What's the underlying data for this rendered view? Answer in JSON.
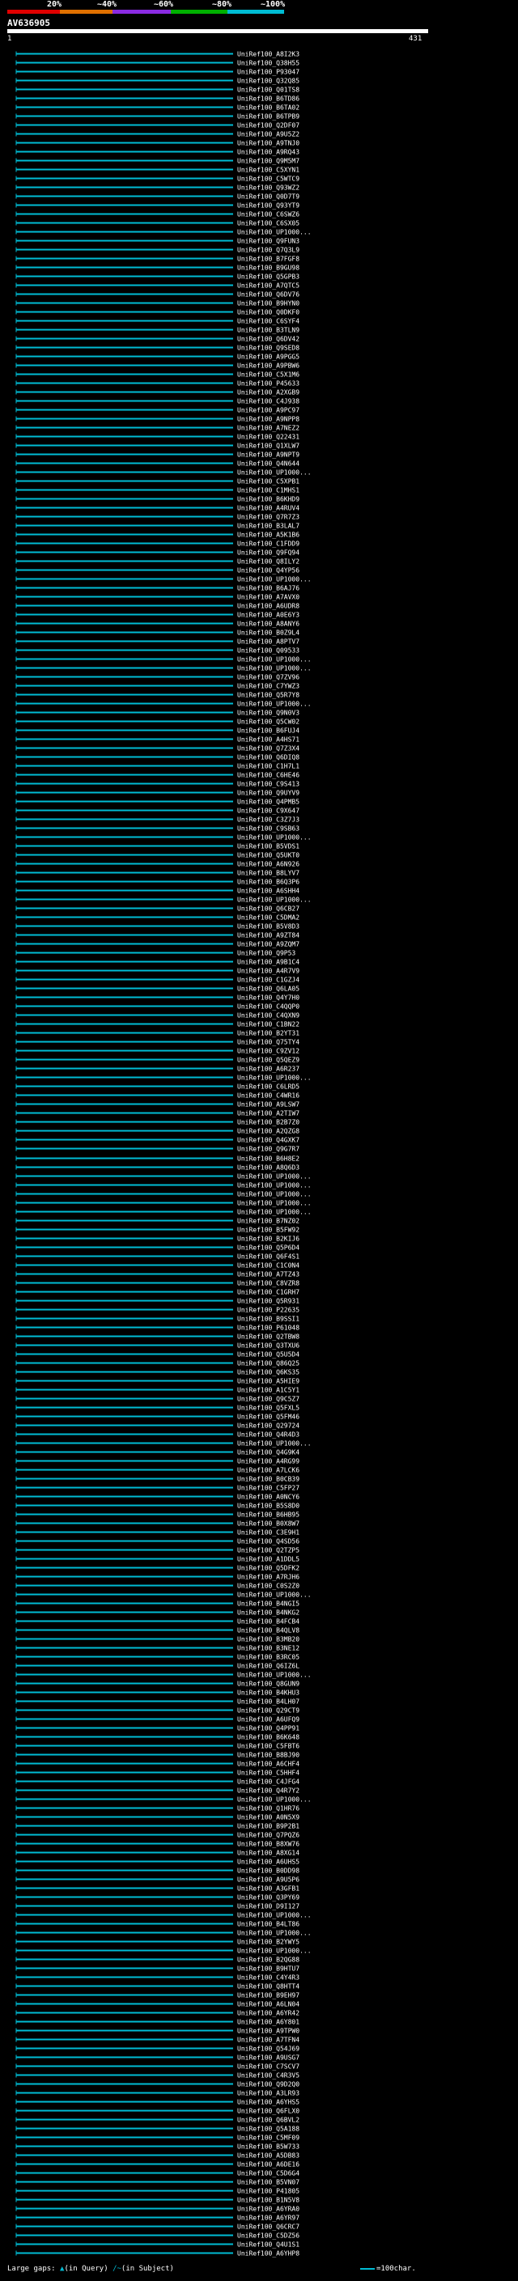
{
  "scale": {
    "labels": [
      "20%",
      "~40%",
      "~60%",
      "~80%",
      "~100%"
    ],
    "colors": [
      "#e00000",
      "#e07000",
      "#8a2be2",
      "#00b000",
      "#00bcd4"
    ]
  },
  "query": {
    "name": "AV636905",
    "start": "1",
    "end": "431"
  },
  "hit_color": "#00bcd4",
  "query_color": "#ffffff",
  "hits": [
    "UniRef100_A8I2K3",
    "UniRef100_Q38H55",
    "UniRef100_P93047",
    "UniRef100_Q32Q85",
    "UniRef100_Q01TS8",
    "UniRef100_B6TD86",
    "UniRef100_B6TA02",
    "UniRef100_B6TPB9",
    "UniRef100_Q2DF07",
    "UniRef100_A9U5Z2",
    "UniRef100_A9TNJ0",
    "UniRef100_A9RQ43",
    "UniRef100_Q9M5M7",
    "UniRef100_C5XYN1",
    "UniRef100_C5WTC9",
    "UniRef100_Q93WZ2",
    "UniRef100_Q0D7T9",
    "UniRef100_Q93YT9",
    "UniRef100_C6SWZ6",
    "UniRef100_C6SX05",
    "UniRef100_UP1000...",
    "UniRef100_Q9FUN3",
    "UniRef100_Q7Q3L9",
    "UniRef100_B7FGF8",
    "UniRef100_B9GU98",
    "UniRef100_Q5GPB3",
    "UniRef100_A7QTC5",
    "UniRef100_Q6DV76",
    "UniRef100_B9HYN0",
    "UniRef100_Q0DKF0",
    "UniRef100_C6SYF4",
    "UniRef100_B3TLN9",
    "UniRef100_Q6DV42",
    "UniRef100_Q9SED8",
    "UniRef100_A9PGG5",
    "UniRef100_A9PBW6",
    "UniRef100_C5X1M6",
    "UniRef100_P45633",
    "UniRef100_A2XGB9",
    "UniRef100_C4J938",
    "UniRef100_A9PC97",
    "UniRef100_A9NPP8",
    "UniRef100_A7NEZ2",
    "UniRef100_Q22431",
    "UniRef100_Q1XLW7",
    "UniRef100_A9NPT9",
    "UniRef100_Q4N644",
    "UniRef100_UP1000...",
    "UniRef100_C5XPB1",
    "UniRef100_C1MHS1",
    "UniRef100_B6KHD9",
    "UniRef100_A4RUV4",
    "UniRef100_Q7R7Z3",
    "UniRef100_B3LAL7",
    "UniRef100_A5K1B6",
    "UniRef100_C1FDD9",
    "UniRef100_Q9FQ94",
    "UniRef100_Q8ILY2",
    "UniRef100_Q4YP56",
    "UniRef100_UP1000...",
    "UniRef100_B6AJ76",
    "UniRef100_A7AVX0",
    "UniRef100_A6UDR8",
    "UniRef100_A0E6Y3",
    "UniRef100_A8ANY6",
    "UniRef100_B0Z9L4",
    "UniRef100_A8PTV7",
    "UniRef100_Q09533",
    "UniRef100_UP1000...",
    "UniRef100_UP1000...",
    "UniRef100_Q7ZV96",
    "UniRef100_C7YWZ3",
    "UniRef100_Q5R7Y8",
    "UniRef100_UP1000...",
    "UniRef100_Q9N0V3",
    "UniRef100_Q5CW02",
    "UniRef100_B6FUJ4",
    "UniRef100_A4HS71",
    "UniRef100_Q7Z3X4",
    "UniRef100_Q6DIQ8",
    "UniRef100_C1H7L1",
    "UniRef100_C6HE46",
    "UniRef100_C9S413",
    "UniRef100_Q9UYV9",
    "UniRef100_Q4PMB5",
    "UniRef100_C9X647",
    "UniRef100_C3Z7J3",
    "UniRef100_C9SB63",
    "UniRef100_UP1000...",
    "UniRef100_B5VDS1",
    "UniRef100_Q5UKT0",
    "UniRef100_A6N926",
    "UniRef100_B8LYV7",
    "UniRef100_B6Q3P6",
    "UniRef100_A6SHH4",
    "UniRef100_UP1000...",
    "UniRef100_Q6CB27",
    "UniRef100_C5DMA2",
    "UniRef100_B5V8D3",
    "UniRef100_A9ZT84",
    "UniRef100_A9ZQM7",
    "UniRef100_Q9P53",
    "UniRef100_A9B1C4",
    "UniRef100_A4R7V9",
    "UniRef100_C1GZJ4",
    "UniRef100_Q6LA05",
    "UniRef100_Q4Y7H0",
    "UniRef100_C4QQP0",
    "UniRef100_C4QXN9",
    "UniRef100_C1BN22",
    "UniRef100_B2YT31",
    "UniRef100_Q75TY4",
    "UniRef100_C9ZV12",
    "UniRef100_Q5QEZ9",
    "UniRef100_A6R237",
    "UniRef100_UP1000...",
    "UniRef100_C6LRD5",
    "UniRef100_C4WR16",
    "UniRef100_A9LSW7",
    "UniRef100_A2TIW7",
    "UniRef100_B2B7Z0",
    "UniRef100_A2QZG8",
    "UniRef100_Q4GXK7",
    "UniRef100_Q9G7R7",
    "UniRef100_B6H8E2",
    "UniRef100_A8Q6D3",
    "UniRef100_UP1000...",
    "UniRef100_UP1000...",
    "UniRef100_UP1000...",
    "UniRef100_UP1000...",
    "UniRef100_UP1000...",
    "UniRef100_B7NZ02",
    "UniRef100_B5FW92",
    "UniRef100_B2KIJ6",
    "UniRef100_Q5P6D4",
    "UniRef100_Q6F4S1",
    "UniRef100_C1C0N4",
    "UniRef100_A7TZ43",
    "UniRef100_C8VZR8",
    "UniRef100_C1GRH7",
    "UniRef100_Q5R931",
    "UniRef100_P22635",
    "UniRef100_B9SSI1",
    "UniRef100_P61048",
    "UniRef100_Q2TBW8",
    "UniRef100_Q3TXU6",
    "UniRef100_Q5U5D4",
    "UniRef100_Q86Q25",
    "UniRef100_Q6KS35",
    "UniRef100_A5HIE9",
    "UniRef100_A1C5Y1",
    "UniRef100_Q9C5Z7",
    "UniRef100_Q5FXL5",
    "UniRef100_Q5FM46",
    "UniRef100_Q29724",
    "UniRef100_Q4R4D3",
    "UniRef100_UP1000...",
    "UniRef100_Q4G9K4",
    "UniRef100_A4RG99",
    "UniRef100_A7LCK6",
    "UniRef100_B0CB39",
    "UniRef100_C5FP27",
    "UniRef100_A0NCY6",
    "UniRef100_B5S8D0",
    "UniRef100_B6HB95",
    "UniRef100_B0X8W7",
    "UniRef100_C3E9H1",
    "UniRef100_Q4SD56",
    "UniRef100_Q2TZP5",
    "UniRef100_A1DDL5",
    "UniRef100_Q5DFK2",
    "UniRef100_A7RJH6",
    "UniRef100_C0S2Z0",
    "UniRef100_UP1000...",
    "UniRef100_B4NGI5",
    "UniRef100_B4NKG2",
    "UniRef100_B4FCB4",
    "UniRef100_B4QLV8",
    "UniRef100_B3MB20",
    "UniRef100_B3NE12",
    "UniRef100_B3RC05",
    "UniRef100_Q6IZ6L",
    "UniRef100_UP1000...",
    "UniRef100_Q8GUN9",
    "UniRef100_B4KHU3",
    "UniRef100_B4LH07",
    "UniRef100_Q29CT9",
    "UniRef100_A6UFQ9",
    "UniRef100_Q4PP91",
    "UniRef100_B6K648",
    "UniRef100_C5FBT6",
    "UniRef100_B8BJ90",
    "UniRef100_A6CHF4",
    "UniRef100_C5HHF4",
    "UniRef100_C4JFG4",
    "UniRef100_Q4R7Y2",
    "UniRef100_UP1000...",
    "UniRef100_Q1HR76",
    "UniRef100_A0N5X9",
    "UniRef100_B9P2B1",
    "UniRef100_Q7PQZ6",
    "UniRef100_B8XW76",
    "UniRef100_A8XG14",
    "UniRef100_A6UHS5",
    "UniRef100_B0DD98",
    "UniRef100_A9U5P6",
    "UniRef100_A3GFB1",
    "UniRef100_Q3PY69",
    "UniRef100_D9I127",
    "UniRef100_UP1000...",
    "UniRef100_B4LT86",
    "UniRef100_UP1000...",
    "UniRef100_B2YWY5",
    "UniRef100_UP1000...",
    "UniRef100_B2QG88",
    "UniRef100_B9HTU7",
    "UniRef100_C4Y4R3",
    "UniRef100_Q8HTT4",
    "UniRef100_B9EH97",
    "UniRef100_A6LN04",
    "UniRef100_A6YR42",
    "UniRef100_A6Y801",
    "UniRef100_A9TPW0",
    "UniRef100_A7TFN4",
    "UniRef100_Q54J69",
    "UniRef100_A9USG7",
    "UniRef100_C7SCV7",
    "UniRef100_C4R3V5",
    "UniRef100_Q9D2Q0",
    "UniRef100_A3LR93",
    "UniRef100_A6YHS5",
    "UniRef100_Q6FLX0",
    "UniRef100_Q6BVL2",
    "UniRef100_Q5A188",
    "UniRef100_C5MF09",
    "UniRef100_B5W733",
    "UniRef100_A5DB83",
    "UniRef100_A6DE16",
    "UniRef100_C5D6G4",
    "UniRef100_B5VN07",
    "UniRef100_P41805",
    "UniRef100_B1N5V8",
    "UniRef100_A6YRA0",
    "UniRef100_A6YR97",
    "UniRef100_Q6CRC7",
    "UniRef100_C5DZ56",
    "UniRef100_Q4U1S1",
    "UniRef100_A6YHP8"
  ],
  "footer": {
    "large_gaps": "Large gaps:",
    "in_query": "(in Query)",
    "in_subject": "(in Subject)",
    "scale_note": "=100char."
  }
}
